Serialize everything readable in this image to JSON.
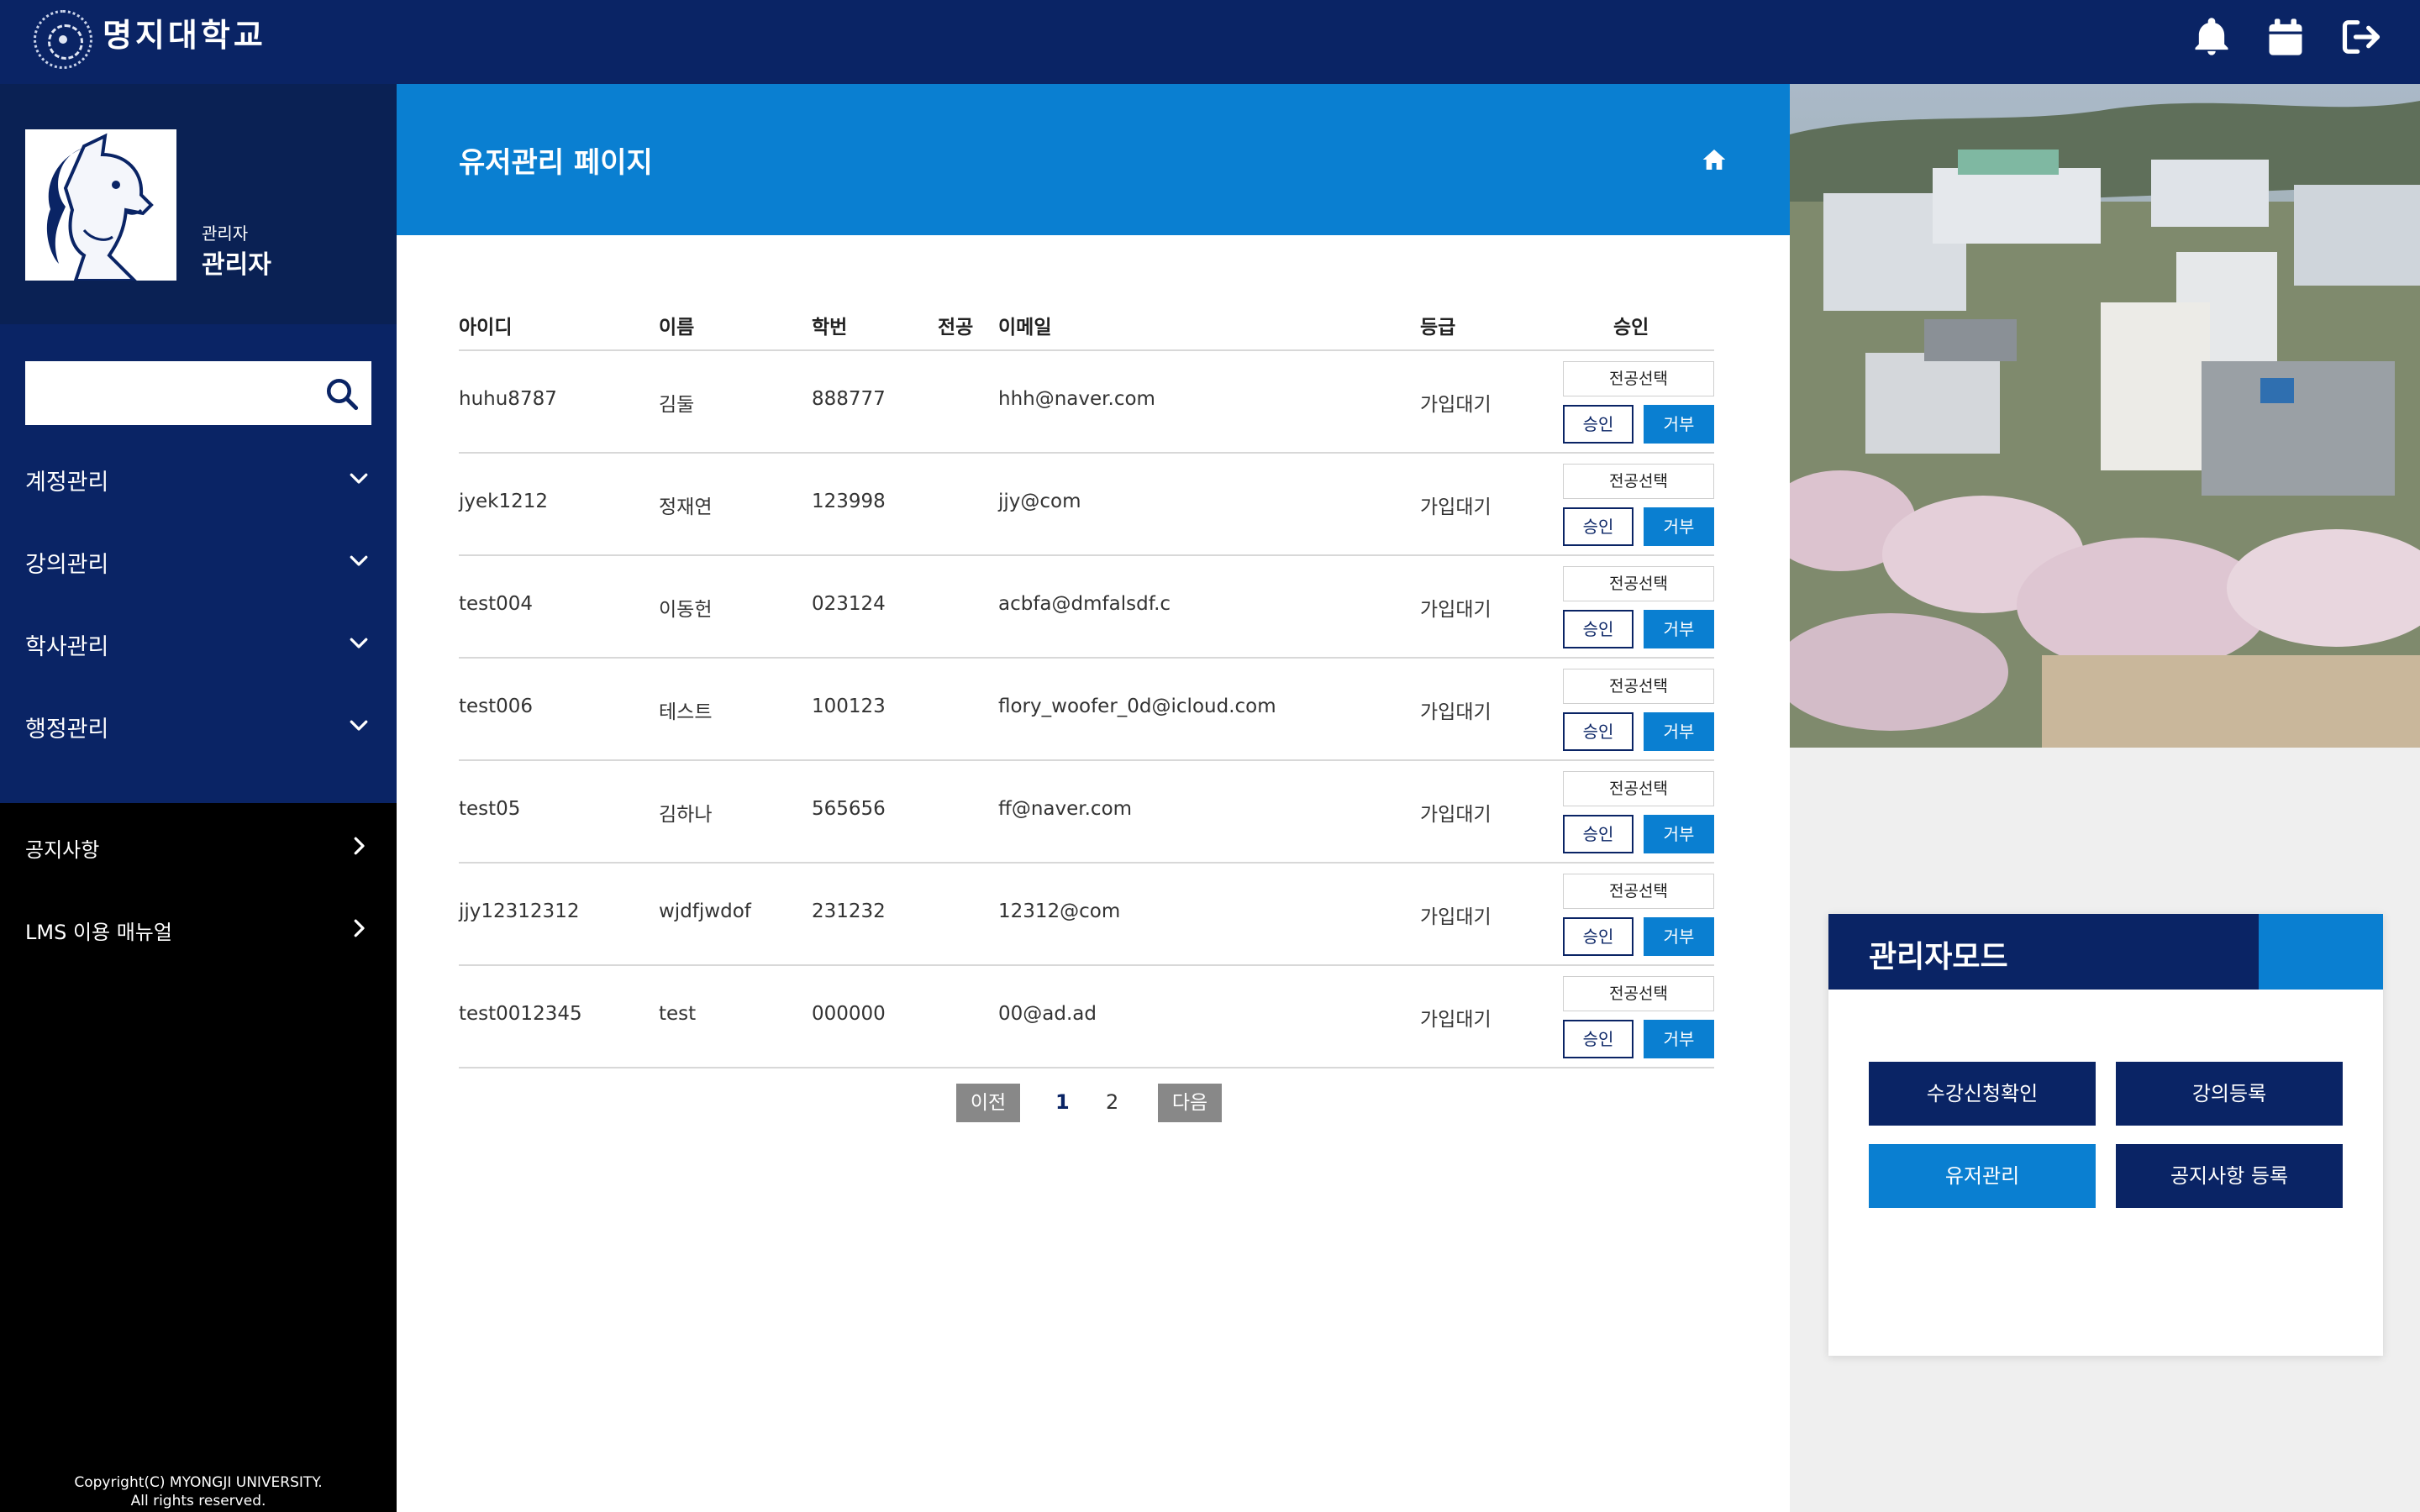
{
  "header": {
    "brand": "명지대학교",
    "icons": [
      "bell-icon",
      "calendar-icon",
      "logout-icon"
    ]
  },
  "sidebar": {
    "role_small": "관리자",
    "role_big": "관리자",
    "search_placeholder": "",
    "menu": [
      {
        "label": "계정관리",
        "icon": "chevron-down-icon"
      },
      {
        "label": "강의관리",
        "icon": "chevron-down-icon"
      },
      {
        "label": "학사관리",
        "icon": "chevron-down-icon"
      },
      {
        "label": "행정관리",
        "icon": "chevron-down-icon"
      }
    ],
    "links": [
      {
        "label": "공지사항",
        "icon": "chevron-right-icon"
      },
      {
        "label": "LMS 이용 매뉴얼",
        "icon": "chevron-right-icon"
      }
    ],
    "copyright_line1": "Copyright(C) MYONGJI UNIVERSITY.",
    "copyright_line2": "All rights reserved."
  },
  "main": {
    "title": "유저관리 페이지",
    "columns": {
      "id": "아이디",
      "name": "이름",
      "student_no": "학번",
      "major": "전공",
      "email": "이메일",
      "grade": "등급",
      "approval": "승인"
    },
    "rows": [
      {
        "id": "huhu8787",
        "name": "김둘",
        "student_no": "888777",
        "major": "",
        "email": "hhh@naver.com",
        "grade": "가입대기",
        "major_select": "전공선택",
        "approve": "승인",
        "reject": "거부"
      },
      {
        "id": "jyek1212",
        "name": "정재연",
        "student_no": "123998",
        "major": "",
        "email": "jjy@com",
        "grade": "가입대기",
        "major_select": "전공선택",
        "approve": "승인",
        "reject": "거부"
      },
      {
        "id": "test004",
        "name": "이동헌",
        "student_no": "023124",
        "major": "",
        "email": "acbfa@dmfalsdf.c",
        "grade": "가입대기",
        "major_select": "전공선택",
        "approve": "승인",
        "reject": "거부"
      },
      {
        "id": "test006",
        "name": "테스트",
        "student_no": "100123",
        "major": "",
        "email": "flory_woofer_0d@icloud.com",
        "grade": "가입대기",
        "major_select": "전공선택",
        "approve": "승인",
        "reject": "거부"
      },
      {
        "id": "test05",
        "name": "김하나",
        "student_no": "565656",
        "major": "",
        "email": "ff@naver.com",
        "grade": "가입대기",
        "major_select": "전공선택",
        "approve": "승인",
        "reject": "거부"
      },
      {
        "id": "jjy12312312",
        "name": "wjdfjwdof",
        "student_no": "231232",
        "major": "",
        "email": "12312@com",
        "grade": "가입대기",
        "major_select": "전공선택",
        "approve": "승인",
        "reject": "거부"
      },
      {
        "id": "test0012345",
        "name": "test",
        "student_no": "000000",
        "major": "",
        "email": "00@ad.ad",
        "grade": "가입대기",
        "major_select": "전공선택",
        "approve": "승인",
        "reject": "거부"
      }
    ],
    "pagination": {
      "prev": "이전",
      "pages": [
        "1",
        "2"
      ],
      "current": "1",
      "next": "다음"
    }
  },
  "admin_panel": {
    "title": "관리자모드",
    "buttons": [
      {
        "label": "수강신청확인",
        "color": "#0a2465"
      },
      {
        "label": "강의등록",
        "color": "#0a2465"
      },
      {
        "label": "유저관리",
        "color": "#0a7fd1"
      },
      {
        "label": "공지사항 등록",
        "color": "#0a2465"
      }
    ]
  },
  "colors": {
    "navy": "#0a2465",
    "blue": "#0a7fd1",
    "black": "#000000"
  }
}
